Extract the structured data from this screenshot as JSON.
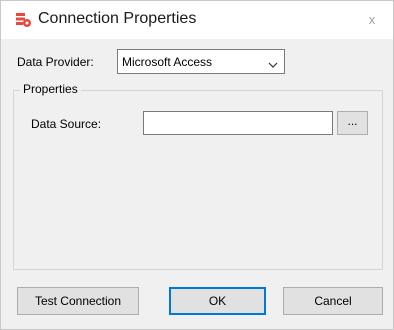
{
  "window": {
    "title": "Connection Properties",
    "close_glyph": "x"
  },
  "data_provider": {
    "label": "Data Provider:",
    "selected": "Microsoft Access"
  },
  "properties": {
    "legend": "Properties",
    "data_source_label": "Data Source:",
    "data_source_value": "",
    "browse_label": "..."
  },
  "buttons": {
    "test_connection": "Test Connection",
    "ok": "OK",
    "cancel": "Cancel"
  },
  "icons": {
    "title": "connection-properties-icon",
    "chevron": "chevron-down-icon"
  },
  "colors": {
    "icon_red": "#e8483d",
    "focus_blue": "#0078d7"
  }
}
